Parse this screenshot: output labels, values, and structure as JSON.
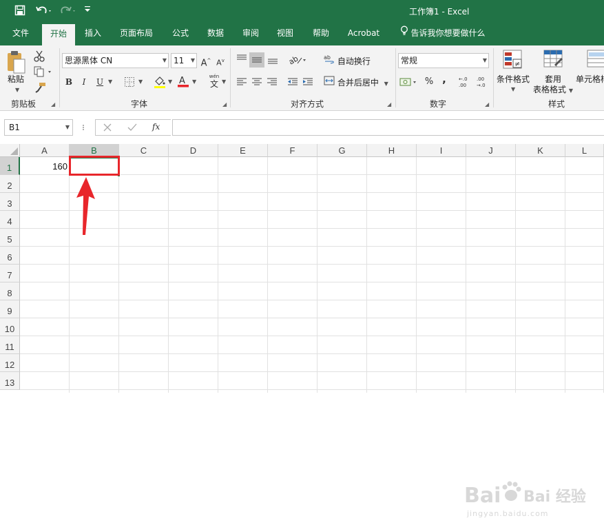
{
  "window": {
    "title": "工作簿1  -  Excel"
  },
  "quick_access": {
    "save": "save-icon",
    "undo": "undo-icon",
    "redo": "redo-icon",
    "customize": "customize-icon"
  },
  "menu": {
    "items": [
      "文件",
      "开始",
      "插入",
      "页面布局",
      "公式",
      "数据",
      "审阅",
      "视图",
      "帮助",
      "Acrobat"
    ],
    "active": "开始",
    "tell_me": "告诉我你想要做什么"
  },
  "ribbon": {
    "clipboard": {
      "paste": "粘贴",
      "label": "剪贴板"
    },
    "font": {
      "name": "思源黑体 CN",
      "size": "11",
      "bold": "B",
      "italic": "I",
      "underline": "U",
      "label": "字体",
      "wen": "wén"
    },
    "alignment": {
      "wrap": "自动换行",
      "merge": "合并后居中",
      "label": "对齐方式"
    },
    "number": {
      "format": "常规",
      "label": "数字",
      "percent": "%",
      "comma": ",",
      "inc": "+.0 .00",
      "dec": ".00 +.0"
    },
    "styles": {
      "conditional": "条件格式",
      "table_line1": "套用",
      "table_line2": "表格格式",
      "cell": "单元格样",
      "label": "样式"
    }
  },
  "formula_bar": {
    "name_box": "B1",
    "fx": "fx",
    "content": ""
  },
  "grid": {
    "columns": [
      "A",
      "B",
      "C",
      "D",
      "E",
      "F",
      "G",
      "H",
      "I",
      "J",
      "K",
      "L"
    ],
    "rows": [
      "1",
      "2",
      "3",
      "4",
      "5",
      "6",
      "7",
      "8",
      "9",
      "10",
      "11",
      "12",
      "13"
    ],
    "selected_cell": "B1",
    "cells": {
      "A1": "160"
    }
  },
  "watermark": {
    "text": "Bai 经验",
    "url": "jingyan.baidu.com"
  },
  "colors": {
    "excel_green": "#217346",
    "highlight_red": "#e8262b"
  }
}
